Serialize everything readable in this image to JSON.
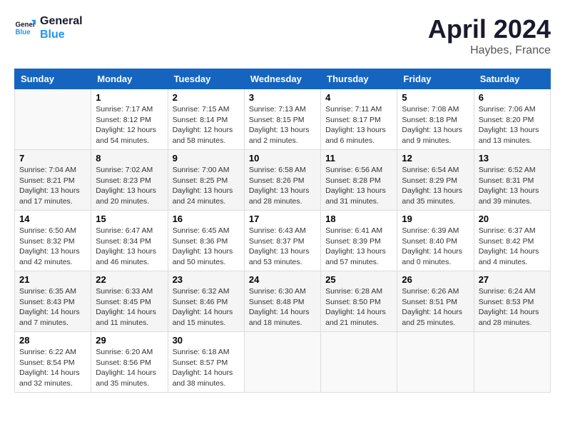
{
  "header": {
    "logo_line1": "General",
    "logo_line2": "Blue",
    "month": "April 2024",
    "location": "Haybes, France"
  },
  "days_of_week": [
    "Sunday",
    "Monday",
    "Tuesday",
    "Wednesday",
    "Thursday",
    "Friday",
    "Saturday"
  ],
  "weeks": [
    [
      {
        "day": "",
        "sunrise": "",
        "sunset": "",
        "daylight": ""
      },
      {
        "day": "1",
        "sunrise": "Sunrise: 7:17 AM",
        "sunset": "Sunset: 8:12 PM",
        "daylight": "Daylight: 12 hours and 54 minutes."
      },
      {
        "day": "2",
        "sunrise": "Sunrise: 7:15 AM",
        "sunset": "Sunset: 8:14 PM",
        "daylight": "Daylight: 12 hours and 58 minutes."
      },
      {
        "day": "3",
        "sunrise": "Sunrise: 7:13 AM",
        "sunset": "Sunset: 8:15 PM",
        "daylight": "Daylight: 13 hours and 2 minutes."
      },
      {
        "day": "4",
        "sunrise": "Sunrise: 7:11 AM",
        "sunset": "Sunset: 8:17 PM",
        "daylight": "Daylight: 13 hours and 6 minutes."
      },
      {
        "day": "5",
        "sunrise": "Sunrise: 7:08 AM",
        "sunset": "Sunset: 8:18 PM",
        "daylight": "Daylight: 13 hours and 9 minutes."
      },
      {
        "day": "6",
        "sunrise": "Sunrise: 7:06 AM",
        "sunset": "Sunset: 8:20 PM",
        "daylight": "Daylight: 13 hours and 13 minutes."
      }
    ],
    [
      {
        "day": "7",
        "sunrise": "Sunrise: 7:04 AM",
        "sunset": "Sunset: 8:21 PM",
        "daylight": "Daylight: 13 hours and 17 minutes."
      },
      {
        "day": "8",
        "sunrise": "Sunrise: 7:02 AM",
        "sunset": "Sunset: 8:23 PM",
        "daylight": "Daylight: 13 hours and 20 minutes."
      },
      {
        "day": "9",
        "sunrise": "Sunrise: 7:00 AM",
        "sunset": "Sunset: 8:25 PM",
        "daylight": "Daylight: 13 hours and 24 minutes."
      },
      {
        "day": "10",
        "sunrise": "Sunrise: 6:58 AM",
        "sunset": "Sunset: 8:26 PM",
        "daylight": "Daylight: 13 hours and 28 minutes."
      },
      {
        "day": "11",
        "sunrise": "Sunrise: 6:56 AM",
        "sunset": "Sunset: 8:28 PM",
        "daylight": "Daylight: 13 hours and 31 minutes."
      },
      {
        "day": "12",
        "sunrise": "Sunrise: 6:54 AM",
        "sunset": "Sunset: 8:29 PM",
        "daylight": "Daylight: 13 hours and 35 minutes."
      },
      {
        "day": "13",
        "sunrise": "Sunrise: 6:52 AM",
        "sunset": "Sunset: 8:31 PM",
        "daylight": "Daylight: 13 hours and 39 minutes."
      }
    ],
    [
      {
        "day": "14",
        "sunrise": "Sunrise: 6:50 AM",
        "sunset": "Sunset: 8:32 PM",
        "daylight": "Daylight: 13 hours and 42 minutes."
      },
      {
        "day": "15",
        "sunrise": "Sunrise: 6:47 AM",
        "sunset": "Sunset: 8:34 PM",
        "daylight": "Daylight: 13 hours and 46 minutes."
      },
      {
        "day": "16",
        "sunrise": "Sunrise: 6:45 AM",
        "sunset": "Sunset: 8:36 PM",
        "daylight": "Daylight: 13 hours and 50 minutes."
      },
      {
        "day": "17",
        "sunrise": "Sunrise: 6:43 AM",
        "sunset": "Sunset: 8:37 PM",
        "daylight": "Daylight: 13 hours and 53 minutes."
      },
      {
        "day": "18",
        "sunrise": "Sunrise: 6:41 AM",
        "sunset": "Sunset: 8:39 PM",
        "daylight": "Daylight: 13 hours and 57 minutes."
      },
      {
        "day": "19",
        "sunrise": "Sunrise: 6:39 AM",
        "sunset": "Sunset: 8:40 PM",
        "daylight": "Daylight: 14 hours and 0 minutes."
      },
      {
        "day": "20",
        "sunrise": "Sunrise: 6:37 AM",
        "sunset": "Sunset: 8:42 PM",
        "daylight": "Daylight: 14 hours and 4 minutes."
      }
    ],
    [
      {
        "day": "21",
        "sunrise": "Sunrise: 6:35 AM",
        "sunset": "Sunset: 8:43 PM",
        "daylight": "Daylight: 14 hours and 7 minutes."
      },
      {
        "day": "22",
        "sunrise": "Sunrise: 6:33 AM",
        "sunset": "Sunset: 8:45 PM",
        "daylight": "Daylight: 14 hours and 11 minutes."
      },
      {
        "day": "23",
        "sunrise": "Sunrise: 6:32 AM",
        "sunset": "Sunset: 8:46 PM",
        "daylight": "Daylight: 14 hours and 15 minutes."
      },
      {
        "day": "24",
        "sunrise": "Sunrise: 6:30 AM",
        "sunset": "Sunset: 8:48 PM",
        "daylight": "Daylight: 14 hours and 18 minutes."
      },
      {
        "day": "25",
        "sunrise": "Sunrise: 6:28 AM",
        "sunset": "Sunset: 8:50 PM",
        "daylight": "Daylight: 14 hours and 21 minutes."
      },
      {
        "day": "26",
        "sunrise": "Sunrise: 6:26 AM",
        "sunset": "Sunset: 8:51 PM",
        "daylight": "Daylight: 14 hours and 25 minutes."
      },
      {
        "day": "27",
        "sunrise": "Sunrise: 6:24 AM",
        "sunset": "Sunset: 8:53 PM",
        "daylight": "Daylight: 14 hours and 28 minutes."
      }
    ],
    [
      {
        "day": "28",
        "sunrise": "Sunrise: 6:22 AM",
        "sunset": "Sunset: 8:54 PM",
        "daylight": "Daylight: 14 hours and 32 minutes."
      },
      {
        "day": "29",
        "sunrise": "Sunrise: 6:20 AM",
        "sunset": "Sunset: 8:56 PM",
        "daylight": "Daylight: 14 hours and 35 minutes."
      },
      {
        "day": "30",
        "sunrise": "Sunrise: 6:18 AM",
        "sunset": "Sunset: 8:57 PM",
        "daylight": "Daylight: 14 hours and 38 minutes."
      },
      {
        "day": "",
        "sunrise": "",
        "sunset": "",
        "daylight": ""
      },
      {
        "day": "",
        "sunrise": "",
        "sunset": "",
        "daylight": ""
      },
      {
        "day": "",
        "sunrise": "",
        "sunset": "",
        "daylight": ""
      },
      {
        "day": "",
        "sunrise": "",
        "sunset": "",
        "daylight": ""
      }
    ]
  ]
}
